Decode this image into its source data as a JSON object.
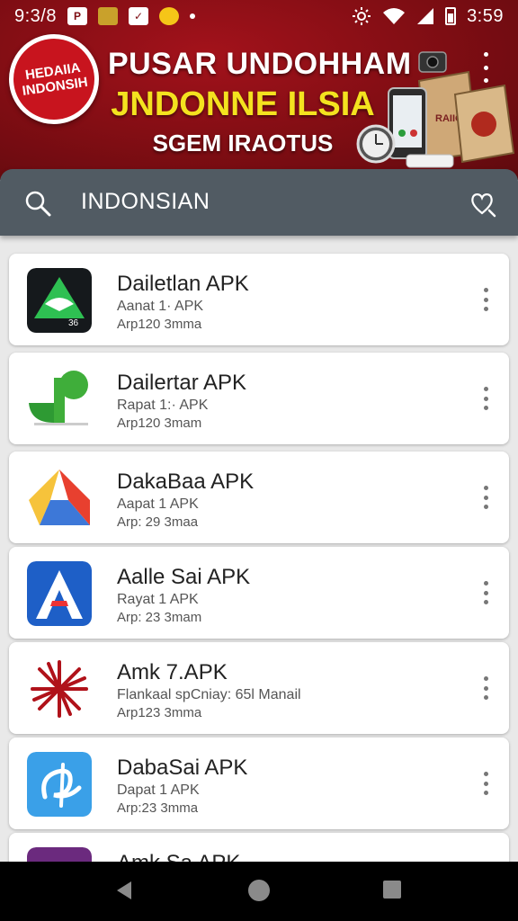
{
  "status_bar": {
    "time": "9:3/8",
    "clock": "3:59",
    "icons_left": [
      "P",
      "",
      "✓",
      "●"
    ],
    "icons_right": [
      "brightness-icon",
      "wifi-icon",
      "signal-icon",
      "battery-icon"
    ]
  },
  "banner": {
    "badge_line1": "HEDAIIA",
    "badge_line2": "INDONSIH",
    "title_line1": "PUSAR UNDOHHAM",
    "title_line2": "JNDONNE ILSIA",
    "title_line3": "SGEM IRAOTUS",
    "colors": {
      "bg": "#7e0d13",
      "accent": "#f4e21f"
    }
  },
  "search": {
    "query": "INDONSIAN"
  },
  "apps": [
    {
      "name": "Dailetlan APK",
      "sub": "Aanat 1· APK",
      "meta": "Arp120 3mma",
      "icon": "triangle-logo-icon"
    },
    {
      "name": "Dailertar APK",
      "sub": "Rapat 1:· APK",
      "meta": "Arp120 3mam",
      "icon": "green-leaf-logo-icon"
    },
    {
      "name": "DakaBaa APK",
      "sub": "Aapat 1 APK",
      "meta": "Arp: 29 3maa",
      "icon": "yellow-star-logo-icon"
    },
    {
      "name": "Aalle Sai APK",
      "sub": "Rayat 1 APK",
      "meta": "Arp: 23 3mam",
      "icon": "blue-a-logo-icon"
    },
    {
      "name": "Amk 7.APK",
      "sub": "Flankaal spCniay: 65l Manail",
      "meta": "Arp123 3mma",
      "icon": "red-burst-logo-icon"
    },
    {
      "name": "DabaSai APK",
      "sub": "Dapat 1 APK",
      "meta": "Arp:23 3mma",
      "icon": "blue-script-logo-icon"
    },
    {
      "name": "Amk Sa APK",
      "sub": "",
      "meta": "",
      "icon": "purple-logo-icon"
    }
  ],
  "nav": {
    "buttons": [
      "back-icon",
      "home-icon",
      "recents-icon"
    ]
  }
}
